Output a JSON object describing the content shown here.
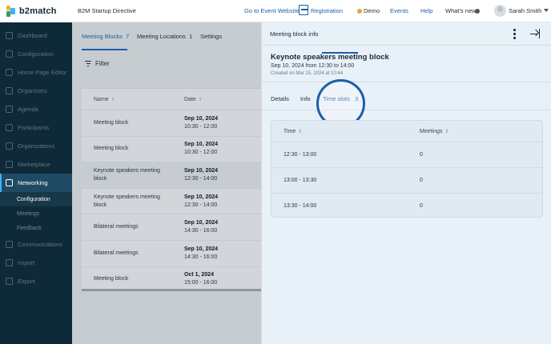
{
  "sidebar": {
    "logo": "b2match",
    "items": [
      {
        "label": "Dashboard",
        "icon": "dashboard-icon"
      },
      {
        "label": "Configuration",
        "icon": "wrench-icon"
      },
      {
        "label": "Home Page Editor",
        "icon": "home-icon"
      },
      {
        "label": "Organizers",
        "icon": "user-icon"
      },
      {
        "label": "Agenda",
        "icon": "calendar-icon"
      },
      {
        "label": "Participants",
        "icon": "users-icon"
      },
      {
        "label": "Organizations",
        "icon": "building-icon"
      },
      {
        "label": "Marketplace",
        "icon": "store-icon"
      },
      {
        "label": "Networking",
        "icon": "handshake-icon"
      },
      {
        "label": "Communications",
        "icon": "chat-icon"
      },
      {
        "label": "Import",
        "icon": "import-icon"
      },
      {
        "label": "Export",
        "icon": "export-icon"
      }
    ],
    "networking_sub": [
      "Configuration",
      "Meetings",
      "Feedback"
    ]
  },
  "topbar": {
    "project_title": "B2M Startup Directive",
    "event_website": "Go to Event Website",
    "registration": "Registration",
    "demo": "Demo",
    "events": "Events",
    "help": "Help",
    "whats_new": "What's new",
    "user_name": "Sarah Smith"
  },
  "main": {
    "tabs": [
      {
        "label": "Meeting Blocks",
        "count": "7"
      },
      {
        "label": "Meeting Locations",
        "count": "1"
      },
      {
        "label": "Settings",
        "count": ""
      }
    ],
    "filter_label": "Filter",
    "columns": [
      "Name",
      "Date"
    ],
    "rows": [
      {
        "name": "Meeting block",
        "date": "Sep 10, 2024",
        "time": "10:30 - 12:00"
      },
      {
        "name": "Meeting block",
        "date": "Sep 10, 2024",
        "time": "10:30 - 12:00"
      },
      {
        "name": "Keynote speakers meeting block",
        "date": "Sep 10, 2024",
        "time": "12:30 - 14:00"
      },
      {
        "name": "Keynote speakers meeting block",
        "date": "Sep 10, 2024",
        "time": "12:30 - 14:00"
      },
      {
        "name": "Bilateral meetings",
        "date": "Sep 10, 2024",
        "time": "14:30 - 16:00"
      },
      {
        "name": "Bilateral meetings",
        "date": "Sep 10, 2024",
        "time": "14:30 - 16:00"
      },
      {
        "name": "Meeting block",
        "date": "Oct 1, 2024",
        "time": "15:00 - 16:00"
      }
    ]
  },
  "panel": {
    "header_title": "Meeting block info",
    "block_title": "Keynote speakers meeting block",
    "block_when": "Sep 10, 2024 from 12:30 to 14:00",
    "block_created": "Created on Mar 15, 2024 at 10:44",
    "subtabs": [
      {
        "label": "Details",
        "count": ""
      },
      {
        "label": "Info",
        "count": ""
      },
      {
        "label": "Time slots",
        "count": "3"
      }
    ],
    "slot_columns": [
      "Time",
      "Meetings"
    ],
    "slots": [
      {
        "time": "12:30 - 13:00",
        "meetings": "0"
      },
      {
        "time": "13:00 - 13:30",
        "meetings": "0"
      },
      {
        "time": "13:30 - 14:00",
        "meetings": "0"
      }
    ]
  },
  "colors": {
    "sidebar_bg": "#0e2a38",
    "accent": "#1b5fa8",
    "panel_bg": "#e8f1f8",
    "demo_dot": "#e9a23b"
  }
}
